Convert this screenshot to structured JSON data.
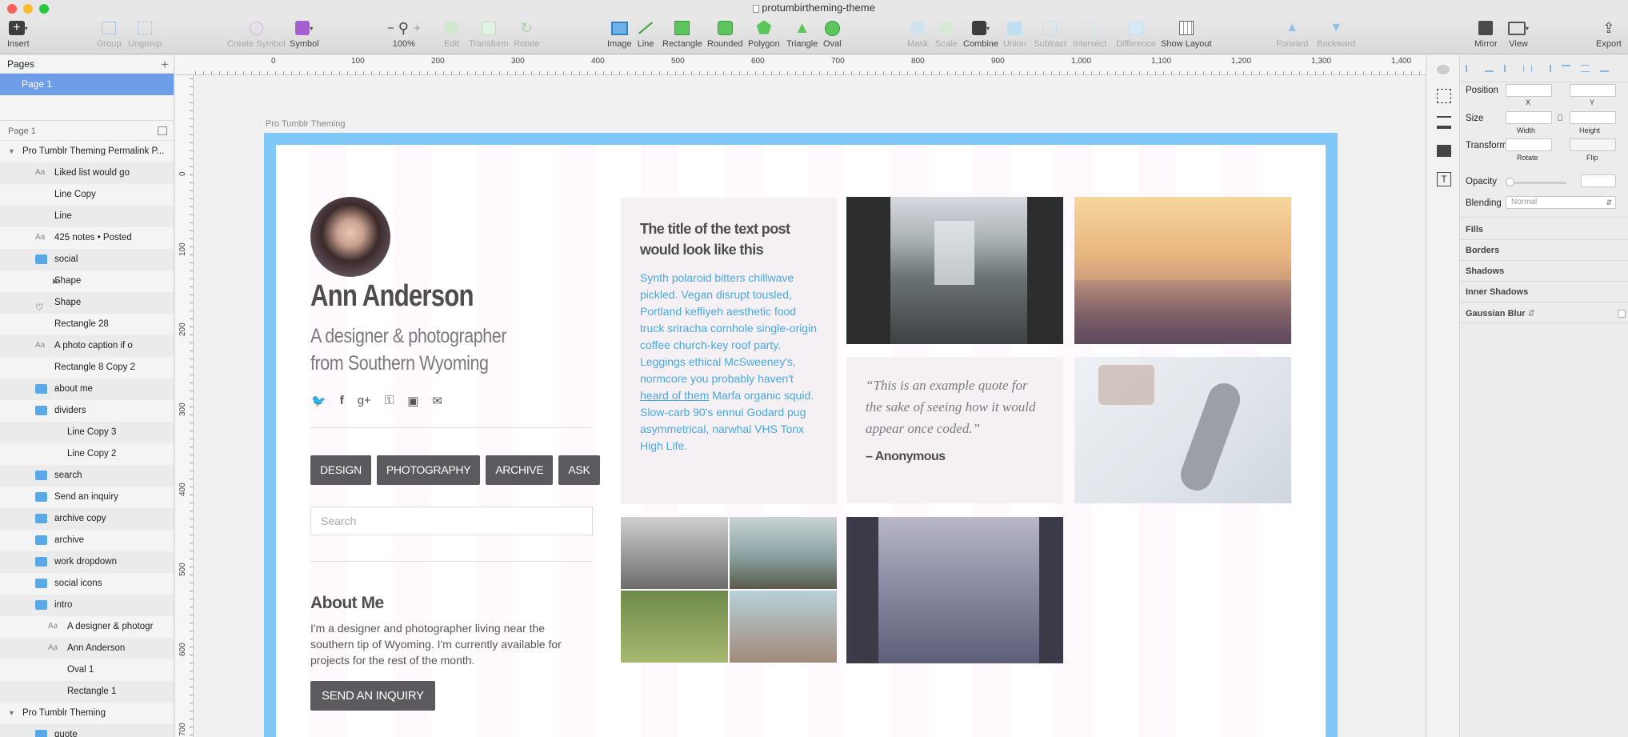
{
  "window": {
    "title": "protumbirtheming-theme",
    "close_color": "#fc5f57",
    "min_color": "#fdbc2e",
    "max_color": "#28c840"
  },
  "toolbar": {
    "insert": "Insert",
    "group": "Group",
    "ungroup": "Ungroup",
    "create_symbol": "Create Symbol",
    "symbol": "Symbol",
    "zoom_minus": "−",
    "zoom_plus": "+",
    "zoom": "100%",
    "edit": "Edit",
    "transform": "Transform",
    "rotate": "Rotate",
    "image": "Image",
    "line": "Line",
    "rectangle": "Rectangle",
    "rounded": "Rounded",
    "polygon": "Polygon",
    "triangle": "Triangle",
    "oval": "Oval",
    "mask": "Mask",
    "scale": "Scale",
    "combine": "Combine",
    "union": "Union",
    "subtract": "Subtract",
    "intersect": "Intersect",
    "difference": "Difference",
    "show_layout": "Show Layout",
    "forward": "Forward",
    "backward": "Backward",
    "mirror": "Mirror",
    "view": "View",
    "export": "Export"
  },
  "sidebar": {
    "pages_header": "Pages",
    "selected_page": "Page 1",
    "layers_header": "Page 1",
    "layers": [
      {
        "label": "Pro Tumblr Theming Permalink P...",
        "indent": 0,
        "arrow": "▼",
        "icon": "none"
      },
      {
        "label": "Liked list would go",
        "indent": 2,
        "arrow": "",
        "icon": "text"
      },
      {
        "label": "Line Copy",
        "indent": 2,
        "arrow": "",
        "icon": "none"
      },
      {
        "label": "Line",
        "indent": 2,
        "arrow": "",
        "icon": "none"
      },
      {
        "label": "425 notes  •  Posted",
        "indent": 2,
        "arrow": "",
        "icon": "text"
      },
      {
        "label": "social",
        "indent": 1,
        "arrow": "▼",
        "icon": "folder"
      },
      {
        "label": "Shape",
        "indent": 2,
        "arrow": "▶",
        "icon": "shape"
      },
      {
        "label": "Shape",
        "indent": 2,
        "arrow": "",
        "icon": "heart"
      },
      {
        "label": "Rectangle 28",
        "indent": 2,
        "arrow": "",
        "icon": "line"
      },
      {
        "label": "A photo caption if o",
        "indent": 2,
        "arrow": "",
        "icon": "text"
      },
      {
        "label": "Rectangle 8 Copy 2",
        "indent": 2,
        "arrow": "",
        "icon": "rect"
      },
      {
        "label": "about me",
        "indent": 1,
        "arrow": "▶",
        "icon": "folder"
      },
      {
        "label": "dividers",
        "indent": 1,
        "arrow": "▼",
        "icon": "folder"
      },
      {
        "label": "Line Copy 3",
        "indent": 3,
        "arrow": "",
        "icon": "none"
      },
      {
        "label": "Line Copy 2",
        "indent": 3,
        "arrow": "",
        "icon": "none"
      },
      {
        "label": "search",
        "indent": 1,
        "arrow": "▶",
        "icon": "folder"
      },
      {
        "label": "Send an inquiry",
        "indent": 1,
        "arrow": "▶",
        "icon": "folder"
      },
      {
        "label": "archive copy",
        "indent": 1,
        "arrow": "▶",
        "icon": "folder"
      },
      {
        "label": "archive",
        "indent": 1,
        "arrow": "▶",
        "icon": "folder"
      },
      {
        "label": "work dropdown",
        "indent": 1,
        "arrow": "▶",
        "icon": "folder"
      },
      {
        "label": "social icons",
        "indent": 1,
        "arrow": "▶",
        "icon": "folder"
      },
      {
        "label": "intro",
        "indent": 1,
        "arrow": "▼",
        "icon": "folder"
      },
      {
        "label": "A designer & photogr",
        "indent": 3,
        "arrow": "",
        "icon": "text"
      },
      {
        "label": "Ann Anderson",
        "indent": 3,
        "arrow": "",
        "icon": "text"
      },
      {
        "label": "Oval 1",
        "indent": 3,
        "arrow": "",
        "icon": "oval"
      },
      {
        "label": "Rectangle 1",
        "indent": 3,
        "arrow": "",
        "icon": "fillrect"
      },
      {
        "label": "Pro Tumblr Theming",
        "indent": 0,
        "arrow": "▼",
        "icon": "none"
      },
      {
        "label": "quote",
        "indent": 1,
        "arrow": "▶",
        "icon": "folder"
      }
    ]
  },
  "rulers": {
    "h_labels": [
      "0",
      "100",
      "200",
      "300",
      "400",
      "500",
      "600",
      "700",
      "800",
      "900",
      "1,000",
      "1,100",
      "1,200",
      "1,300",
      "1,400"
    ],
    "v_labels": [
      "0",
      "100",
      "200",
      "300",
      "400",
      "500",
      "600",
      "700"
    ]
  },
  "artboard": {
    "label": "Pro Tumblr Theming",
    "frame_color": "#7fc8f8",
    "name": "Ann Anderson",
    "tagline": "A designer & photographer from Southern Wyoming",
    "social_icons": [
      "twitter-icon",
      "facebook-icon",
      "google-plus-icon",
      "dribbble-icon",
      "instagram-icon",
      "email-icon"
    ],
    "nav": [
      "DESIGN",
      "PHOTOGRAPHY",
      "ARCHIVE",
      "ASK"
    ],
    "search_placeholder": "Search",
    "about_heading": "About Me",
    "about_text": "I'm a designer and photographer living near the southern tip of Wyoming. I'm currently available for projects for the rest of the month.",
    "inquiry_button": "SEND AN INQUIRY",
    "text_post": {
      "title": "The title of the text post would look like this",
      "body_before": "Synth polaroid bitters chillwave pickled. Vegan disrupt tousled, Portland keffiyeh aesthetic food truck sriracha cornhole single-origin coffee church-key roof party. Leggings ethical McSweeney's, normcore you probably haven't ",
      "body_link": "heard of them",
      "body_after": " Marfa organic squid. Slow-carb 90's ennui Godard pug asymmetrical, narwhal VHS Tonx High Life.",
      "link_color": "#49a9e0"
    },
    "quote": {
      "text": "“This is an example quote for the sake of seeing how it would appear once coded.”",
      "author": "– Anonymous"
    }
  },
  "inspector": {
    "position": "Position",
    "x": "X",
    "y": "Y",
    "size": "Size",
    "width": "Width",
    "height": "Height",
    "transform": "Transform",
    "rotate": "Rotate",
    "flip": "Flip",
    "opacity": "Opacity",
    "blending": "Blending",
    "blending_value": "Normal",
    "fills": "Fills",
    "borders": "Borders",
    "shadows": "Shadows",
    "inner_shadows": "Inner Shadows",
    "gaussian_blur": "Gaussian Blur"
  }
}
